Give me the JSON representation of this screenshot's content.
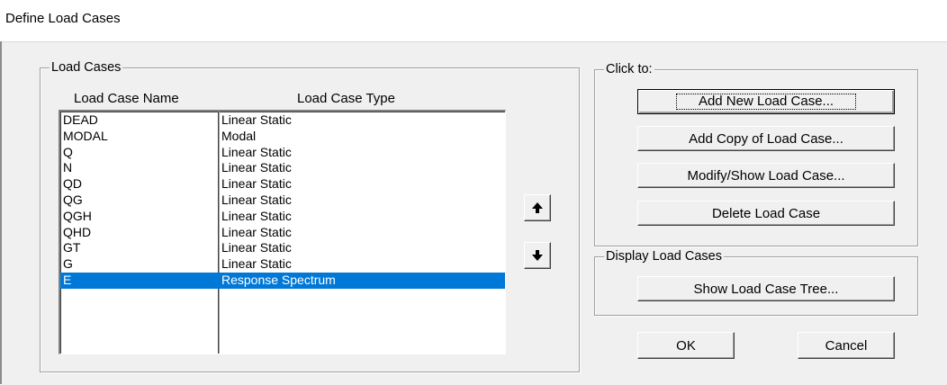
{
  "window": {
    "title": "Define Load Cases"
  },
  "load_cases_group": {
    "legend": "Load Cases",
    "column_headers": {
      "name": "Load Case Name",
      "type": "Load Case Type"
    },
    "rows": [
      {
        "name": "DEAD",
        "type": "Linear Static",
        "selected": false
      },
      {
        "name": "MODAL",
        "type": "Modal",
        "selected": false
      },
      {
        "name": "Q",
        "type": "Linear Static",
        "selected": false
      },
      {
        "name": "N",
        "type": "Linear Static",
        "selected": false
      },
      {
        "name": "QD",
        "type": "Linear Static",
        "selected": false
      },
      {
        "name": "QG",
        "type": "Linear Static",
        "selected": false
      },
      {
        "name": "QGH",
        "type": "Linear Static",
        "selected": false
      },
      {
        "name": "QHD",
        "type": "Linear Static",
        "selected": false
      },
      {
        "name": "GT",
        "type": "Linear Static",
        "selected": false
      },
      {
        "name": "G",
        "type": "Linear Static",
        "selected": false
      },
      {
        "name": "E",
        "type": "Response Spectrum",
        "selected": true
      }
    ],
    "move_up_icon": "arrow-up-icon",
    "move_down_icon": "arrow-down-icon"
  },
  "click_to_group": {
    "legend": "Click to:",
    "buttons": {
      "add_new": "Add New Load Case...",
      "add_copy": "Add Copy of Load Case...",
      "modify_show": "Modify/Show Load Case...",
      "delete": "Delete Load Case"
    }
  },
  "display_group": {
    "legend": "Display Load Cases",
    "show_tree": "Show Load Case Tree..."
  },
  "footer": {
    "ok": "OK",
    "cancel": "Cancel"
  },
  "colors": {
    "dialog_bg": "#f0f0f0",
    "selection": "#0078d7",
    "list_bg": "#ffffff"
  }
}
